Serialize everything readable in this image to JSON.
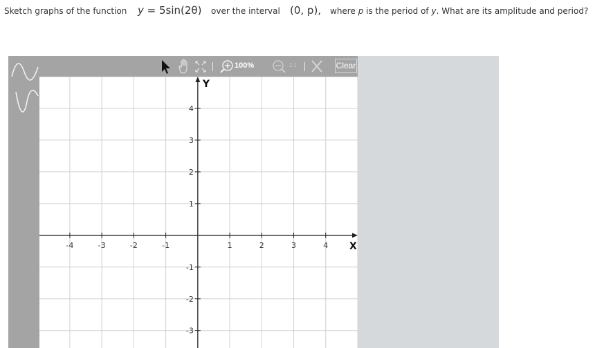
{
  "question": {
    "part1": "Sketch graphs of the function",
    "function_lhs": "y",
    "function_rhs": "= 5sin(2θ)",
    "part2": "over the interval",
    "interval": "(0, p),",
    "part3_a": "where",
    "part3_p": "p",
    "part3_b": "is the period of",
    "part3_y": "y",
    "part3_c": ". What are its amplitude and period?"
  },
  "tools": [
    {
      "name": "sine-curve-tool",
      "icon": "sine-wave-icon"
    },
    {
      "name": "cosine-curve-tool",
      "icon": "cosine-wave-icon"
    }
  ],
  "toolbar": {
    "zoom_label": "100%",
    "onetoone_label": "1:1",
    "clear_label": "Clear"
  },
  "graph": {
    "x_axis_label": "X",
    "y_axis_label": "Y",
    "x_ticks": [
      -4,
      -3,
      -2,
      -1,
      1,
      2,
      3,
      4
    ],
    "y_ticks": [
      4,
      3,
      2,
      1,
      -1,
      -2,
      -3
    ],
    "x_range": [
      -4.95,
      5.0
    ],
    "y_range": [
      -3.55,
      5.0
    ]
  },
  "colors": {
    "toolbar": "#a4a4a4",
    "panel": "#d5d9dc",
    "grid": "#d0d0d0",
    "axis": "#222222"
  }
}
